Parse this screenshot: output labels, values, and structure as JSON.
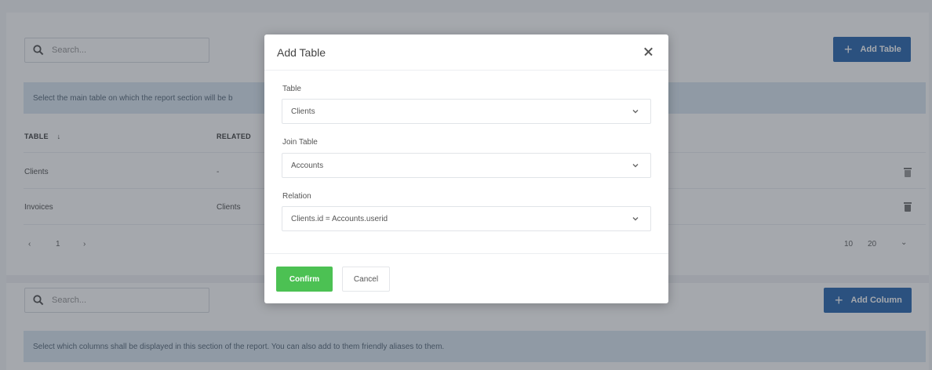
{
  "top_section": {
    "search_placeholder": "Search...",
    "add_button_label": "Add Table",
    "info_text": "Select the main table on which the report section will be b",
    "columns": {
      "table": "TABLE",
      "sort_icon": "arrow-down-icon",
      "related": "RELATED"
    },
    "rows": [
      {
        "table": "Clients",
        "related": "-"
      },
      {
        "table": "Invoices",
        "related": "Clients"
      }
    ],
    "pagination": {
      "prev": "‹",
      "current": "1",
      "next": "›"
    },
    "page_size": {
      "option1": "10",
      "option2": "20"
    }
  },
  "bottom_section": {
    "search_placeholder": "Search...",
    "add_button_label": "Add Column",
    "info_text": "Select which columns shall be displayed in this section of the report. You can also add to them friendly aliases to them."
  },
  "modal": {
    "title": "Add Table",
    "fields": [
      {
        "label": "Table",
        "value": "Clients"
      },
      {
        "label": "Join Table",
        "value": "Accounts"
      },
      {
        "label": "Relation",
        "value": "Clients.id = Accounts.userid"
      }
    ],
    "confirm_label": "Confirm",
    "cancel_label": "Cancel"
  },
  "colors": {
    "primary": "#2d6ab0",
    "confirm": "#4cc153",
    "info_bg": "#dbe7f1",
    "overlay": "rgba(40,48,60,0.42)"
  }
}
